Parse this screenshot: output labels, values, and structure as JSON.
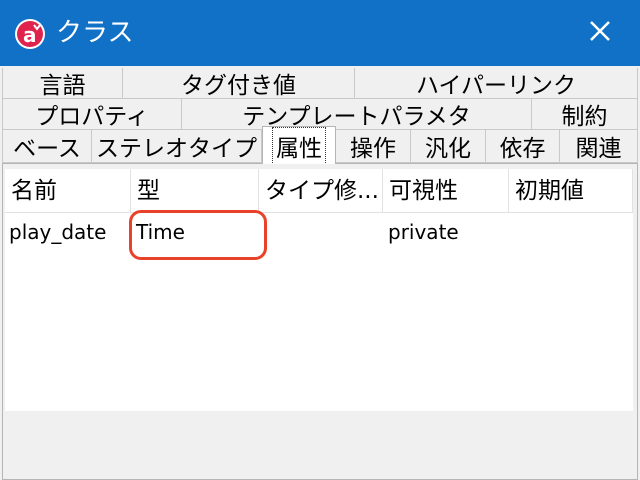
{
  "window": {
    "title": "クラス",
    "app_icon": "astah-icon",
    "close_icon": "close-icon",
    "titlebar_color": "#1171c7"
  },
  "tabs": {
    "row1": [
      "言語",
      "タグ付き値",
      "ハイパーリンク"
    ],
    "row2": [
      "プロパティ",
      "テンプレートパラメタ",
      "制約"
    ],
    "row3": [
      "ベース",
      "ステレオタイプ",
      "属性",
      "操作",
      "汎化",
      "依存",
      "関連"
    ],
    "selected": "属性"
  },
  "table": {
    "columns": [
      "名前",
      "型",
      "タイプ修...",
      "可視性",
      "初期値"
    ],
    "rows": [
      {
        "name": "play_date",
        "type": "Time",
        "type_modifier": "",
        "visibility": "private",
        "initial_value": ""
      }
    ]
  },
  "highlight_color": "#e8432a"
}
